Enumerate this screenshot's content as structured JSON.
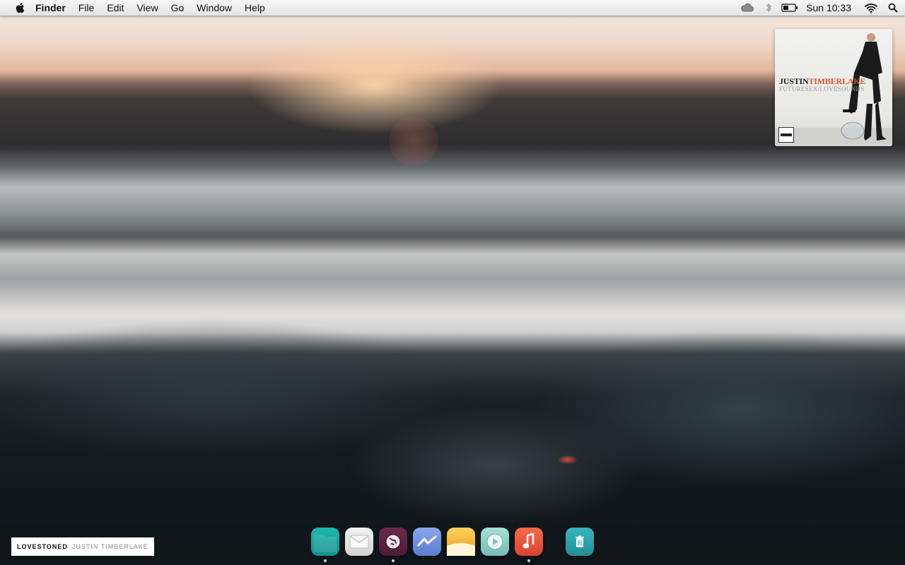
{
  "menubar": {
    "app_name": "Finder",
    "menus": [
      "File",
      "Edit",
      "View",
      "Go",
      "Window",
      "Help"
    ],
    "clock": "Sun 10:33",
    "status_icons": [
      "cloud-icon",
      "bluetooth-icon",
      "battery-icon",
      "wifi-icon",
      "spotlight-search-icon"
    ]
  },
  "album_art": {
    "artist_first": "JUSTIN",
    "artist_last": "TIMBERLAKE",
    "album_title": "FUTURESEX/LOVESOUNDS"
  },
  "now_playing": {
    "track": "LOVESTONED",
    "artist": "JUSTIN TIMBERLAKE"
  },
  "dock": {
    "apps": [
      {
        "name": "finder",
        "color": "#1aa49e",
        "running": true
      },
      {
        "name": "mail",
        "color": "#e6e6e6",
        "running": false
      },
      {
        "name": "web-browser",
        "color": "#5c2442",
        "running": true
      },
      {
        "name": "messages",
        "color": "#6e8fd8",
        "running": false
      },
      {
        "name": "photos",
        "color": "#f2a92a",
        "running": false
      },
      {
        "name": "media-player",
        "color": "#8fd0c9",
        "running": false
      },
      {
        "name": "music",
        "color": "#e9583e",
        "running": true
      },
      {
        "name": "trash",
        "color": "#2aa2ad",
        "running": false
      }
    ]
  },
  "colors": {
    "accent_artist_last": "#d8552f",
    "menubar_bg": "#eeeeee"
  }
}
